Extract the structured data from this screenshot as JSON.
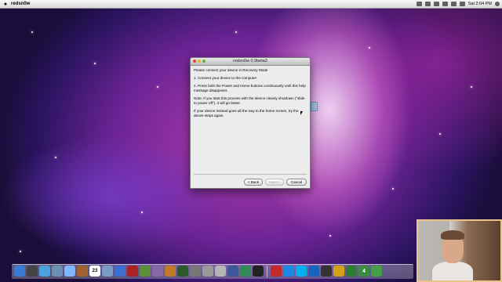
{
  "menubar": {
    "apple": "",
    "app_name": "redsn0w",
    "clock": "Sat 2:04 PM"
  },
  "window": {
    "title": "redsn0w 0.9beta3",
    "paragraphs": [
      "Please connect your device in Recovery Mode",
      "1. Connect your device to the computer",
      "2. Press both the Power and Home buttons continuously until this help message disappears.",
      "Note: If you start this process with the device cleanly shutdown (\"slide to power off\"), it will go faster.",
      "If your device instead goes all the way to the home screen, try the above steps again."
    ],
    "buttons": {
      "back": "< Back",
      "next": "Next >",
      "cancel": "Cancel"
    }
  },
  "dock": {
    "icons": [
      {
        "name": "finder-icon",
        "color": "#3a7bd5"
      },
      {
        "name": "dashboard-icon",
        "color": "#444"
      },
      {
        "name": "safari-icon",
        "color": "#4aa3df"
      },
      {
        "name": "mail-icon",
        "color": "#6d8fb3"
      },
      {
        "name": "ichat-icon",
        "color": "#7fb8ff"
      },
      {
        "name": "address-book-icon",
        "color": "#a0622d"
      },
      {
        "name": "ical-icon",
        "color": "#d33"
      },
      {
        "name": "preview-icon",
        "color": "#7a9cc6"
      },
      {
        "name": "itunes-icon",
        "color": "#3c6fd1"
      },
      {
        "name": "photo-booth-icon",
        "color": "#aa2222"
      },
      {
        "name": "iphoto-icon",
        "color": "#5c8f3a"
      },
      {
        "name": "imovie-icon",
        "color": "#8866aa"
      },
      {
        "name": "garageband-icon",
        "color": "#c07a2a"
      },
      {
        "name": "time-machine-icon",
        "color": "#2a5a2a"
      },
      {
        "name": "system-preferences-icon",
        "color": "#777"
      },
      {
        "name": "disk-utility-icon",
        "color": "#999"
      },
      {
        "name": "script-editor-icon",
        "color": "#b5b5b5"
      },
      {
        "name": "xcode-icon",
        "color": "#3b5998"
      },
      {
        "name": "activity-monitor-icon",
        "color": "#2e8b57"
      },
      {
        "name": "terminal-icon",
        "color": "#222"
      },
      {
        "name": "app-icon-red",
        "color": "#c62828"
      },
      {
        "name": "app-icon-blue",
        "color": "#1e88e5"
      },
      {
        "name": "skype-icon",
        "color": "#00aff0"
      },
      {
        "name": "app-icon-blue-2",
        "color": "#1565c0"
      },
      {
        "name": "iphone-icon",
        "color": "#333"
      },
      {
        "name": "app-icon-star",
        "color": "#d4a017"
      },
      {
        "name": "utorrent-icon",
        "color": "#2e7d32"
      },
      {
        "name": "app-icon-4",
        "color": "#388e3c"
      },
      {
        "name": "app-icon-green",
        "color": "#43a047"
      }
    ],
    "labels": {
      "ical": "23",
      "app4": "4"
    }
  }
}
